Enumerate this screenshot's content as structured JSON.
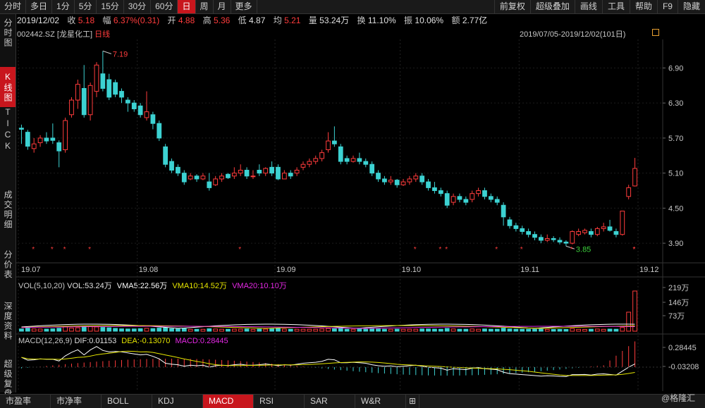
{
  "periods": [
    "分时",
    "多日",
    "1分",
    "5分",
    "15分",
    "30分",
    "60分",
    "日",
    "周",
    "月",
    "更多"
  ],
  "active_period": "日",
  "quote": {
    "date": "2019/12/02",
    "close_label": "收",
    "close": "5.18",
    "change_label": "幅",
    "change": "6.37%(0.31)",
    "open_label": "开",
    "open": "4.88",
    "high_label": "高",
    "high": "5.36",
    "low_label": "低",
    "low": "4.87",
    "avg_label": "均",
    "avg": "5.21",
    "volume_label": "量",
    "volume": "53.24万",
    "turnover_label": "换",
    "turnover": "11.10%",
    "amplitude_label": "振",
    "amplitude": "10.06%",
    "amount_label": "额",
    "amount": "2.77亿"
  },
  "tools": [
    "前复权",
    "超级叠加",
    "画线",
    "工具",
    "帮助",
    "F9",
    "隐藏"
  ],
  "sidebar": [
    "分时图",
    "K线图",
    "TICK",
    "成交明细",
    "分价表",
    "深度资料",
    "超级复盘"
  ],
  "stock": {
    "code": "002442.SZ",
    "name": "[龙星化工]",
    "type": "日线"
  },
  "range": "2019/07/05-2019/12/02(101日)",
  "price_axis": [
    "6.90",
    "6.30",
    "5.70",
    "5.10",
    "4.50",
    "3.90"
  ],
  "date_axis": [
    "19.07",
    "19.08",
    "19.09",
    "19.10",
    "19.11",
    "19.12"
  ],
  "annotations": {
    "high": "7.19",
    "low": "3.85"
  },
  "volume_indicator": {
    "title": "VOL(5,10,20)",
    "vol": "VOL:53.24万",
    "vma5": "VMA5:22.56万",
    "vma10": "VMA10:14.52万",
    "vma20": "VMA20:10.10万",
    "axis": [
      "219万",
      "146万",
      "73万"
    ]
  },
  "macd_indicator": {
    "title": "MACD(12,26,9)",
    "dif": "DIF:0.01153",
    "dea": "DEA:-0.13070",
    "macd": "MACD:0.28445",
    "axis": [
      "0.28445",
      "-0.03208"
    ]
  },
  "bottom_tabs": [
    "市盈率",
    "市净率",
    "BOLL",
    "KDJ",
    "MACD",
    "RSI",
    "SAR",
    "W&R"
  ],
  "active_bottom": "MACD",
  "watermark": "@格隆汇",
  "colors": {
    "up": "#ff3c3c",
    "down": "#3cd2d2",
    "active": "#c8161d",
    "vma5": "#ffffff",
    "vma10": "#e6e600",
    "vma20": "#e628e6"
  },
  "chart_data": {
    "type": "candlestick",
    "ylim": [
      3.6,
      7.4
    ],
    "candles": [
      {
        "o": 5.87,
        "c": 5.85,
        "h": 5.93,
        "l": 5.6
      },
      {
        "o": 5.8,
        "c": 5.56,
        "h": 5.84,
        "l": 5.5
      },
      {
        "o": 5.52,
        "c": 5.6,
        "h": 5.7,
        "l": 5.45
      },
      {
        "o": 5.62,
        "c": 5.7,
        "h": 5.75,
        "l": 5.55
      },
      {
        "o": 5.7,
        "c": 5.65,
        "h": 5.8,
        "l": 5.6
      },
      {
        "o": 5.7,
        "c": 5.66,
        "h": 5.95,
        "l": 5.6
      },
      {
        "o": 5.62,
        "c": 5.48,
        "h": 5.66,
        "l": 5.2
      },
      {
        "o": 5.5,
        "c": 6.0,
        "h": 6.05,
        "l": 5.45
      },
      {
        "o": 6.1,
        "c": 6.35,
        "h": 6.4,
        "l": 6.05
      },
      {
        "o": 6.35,
        "c": 6.62,
        "h": 6.7,
        "l": 6.2
      },
      {
        "o": 6.55,
        "c": 6.1,
        "h": 6.95,
        "l": 6.05
      },
      {
        "o": 6.1,
        "c": 6.6,
        "h": 6.65,
        "l": 6.0
      },
      {
        "o": 6.5,
        "c": 6.95,
        "h": 7.0,
        "l": 6.4
      },
      {
        "o": 6.8,
        "c": 6.55,
        "h": 7.19,
        "l": 6.5
      },
      {
        "o": 6.7,
        "c": 6.4,
        "h": 6.8,
        "l": 6.35
      },
      {
        "o": 6.65,
        "c": 6.45,
        "h": 6.7,
        "l": 6.4
      },
      {
        "o": 6.5,
        "c": 6.4,
        "h": 6.55,
        "l": 6.3
      },
      {
        "o": 6.35,
        "c": 6.3,
        "h": 6.4,
        "l": 6.15
      },
      {
        "o": 6.3,
        "c": 6.2,
        "h": 6.35,
        "l": 6.15
      },
      {
        "o": 6.25,
        "c": 6.1,
        "h": 6.3,
        "l": 6.05
      },
      {
        "o": 6.05,
        "c": 6.15,
        "h": 6.5,
        "l": 6.0
      },
      {
        "o": 6.1,
        "c": 5.95,
        "h": 6.15,
        "l": 5.85
      },
      {
        "o": 5.95,
        "c": 5.7,
        "h": 6.0,
        "l": 5.65
      },
      {
        "o": 5.55,
        "c": 5.25,
        "h": 5.6,
        "l": 5.2
      },
      {
        "o": 5.3,
        "c": 5.15,
        "h": 5.35,
        "l": 5.1
      },
      {
        "o": 5.2,
        "c": 5.1,
        "h": 5.25,
        "l": 5.05
      },
      {
        "o": 5.1,
        "c": 4.95,
        "h": 5.15,
        "l": 4.9
      },
      {
        "o": 5.0,
        "c": 5.05,
        "h": 5.1,
        "l": 4.98
      },
      {
        "o": 5.05,
        "c": 5.0,
        "h": 5.08,
        "l": 4.95
      },
      {
        "o": 5.0,
        "c": 5.05,
        "h": 5.1,
        "l": 4.98
      },
      {
        "o": 4.95,
        "c": 4.85,
        "h": 5.1,
        "l": 4.8
      },
      {
        "o": 4.9,
        "c": 5.0,
        "h": 5.05,
        "l": 4.88
      },
      {
        "o": 5.0,
        "c": 5.05,
        "h": 5.1,
        "l": 4.95
      },
      {
        "o": 5.08,
        "c": 5.02,
        "h": 5.1,
        "l": 5.0
      },
      {
        "o": 5.05,
        "c": 5.1,
        "h": 5.2,
        "l": 5.0
      },
      {
        "o": 5.1,
        "c": 5.15,
        "h": 5.25,
        "l": 5.05
      },
      {
        "o": 5.15,
        "c": 5.05,
        "h": 5.2,
        "l": 5.0
      },
      {
        "o": 5.05,
        "c": 5.05,
        "h": 5.15,
        "l": 5.0
      },
      {
        "o": 5.15,
        "c": 5.1,
        "h": 5.25,
        "l": 5.05
      },
      {
        "o": 5.1,
        "c": 5.18,
        "h": 5.2,
        "l": 5.05
      },
      {
        "o": 5.2,
        "c": 5.1,
        "h": 5.3,
        "l": 5.05
      },
      {
        "o": 5.2,
        "c": 5.0,
        "h": 5.25,
        "l": 4.98
      },
      {
        "o": 5.0,
        "c": 5.1,
        "h": 5.15,
        "l": 5.0
      },
      {
        "o": 5.1,
        "c": 5.05,
        "h": 5.15,
        "l": 5.0
      },
      {
        "o": 5.1,
        "c": 5.15,
        "h": 5.2,
        "l": 5.05
      },
      {
        "o": 5.2,
        "c": 5.25,
        "h": 5.3,
        "l": 5.15
      },
      {
        "o": 5.25,
        "c": 5.3,
        "h": 5.35,
        "l": 5.2
      },
      {
        "o": 5.3,
        "c": 5.35,
        "h": 5.4,
        "l": 5.25
      },
      {
        "o": 5.35,
        "c": 5.45,
        "h": 5.5,
        "l": 5.3
      },
      {
        "o": 5.5,
        "c": 5.65,
        "h": 5.8,
        "l": 5.45
      },
      {
        "o": 5.65,
        "c": 5.6,
        "h": 5.9,
        "l": 5.55
      },
      {
        "o": 5.55,
        "c": 5.3,
        "h": 5.6,
        "l": 5.25
      },
      {
        "o": 5.35,
        "c": 5.3,
        "h": 5.4,
        "l": 5.25
      },
      {
        "o": 5.3,
        "c": 5.35,
        "h": 5.4,
        "l": 5.28
      },
      {
        "o": 5.35,
        "c": 5.3,
        "h": 5.45,
        "l": 5.25
      },
      {
        "o": 5.3,
        "c": 5.25,
        "h": 5.35,
        "l": 5.2
      },
      {
        "o": 5.25,
        "c": 5.1,
        "h": 5.3,
        "l": 5.05
      },
      {
        "o": 5.1,
        "c": 5.0,
        "h": 5.15,
        "l": 4.95
      },
      {
        "o": 5.0,
        "c": 4.95,
        "h": 5.05,
        "l": 4.9
      },
      {
        "o": 4.95,
        "c": 4.98,
        "h": 5.05,
        "l": 4.9
      },
      {
        "o": 4.98,
        "c": 4.9,
        "h": 5.0,
        "l": 4.85
      },
      {
        "o": 4.9,
        "c": 4.95,
        "h": 5.0,
        "l": 4.88
      },
      {
        "o": 4.95,
        "c": 5.0,
        "h": 5.05,
        "l": 4.9
      },
      {
        "o": 5.0,
        "c": 5.05,
        "h": 5.1,
        "l": 4.95
      },
      {
        "o": 5.05,
        "c": 4.95,
        "h": 5.1,
        "l": 4.9
      },
      {
        "o": 4.95,
        "c": 4.85,
        "h": 5.0,
        "l": 4.8
      },
      {
        "o": 4.85,
        "c": 4.8,
        "h": 4.95,
        "l": 4.75
      },
      {
        "o": 4.8,
        "c": 4.75,
        "h": 4.85,
        "l": 4.7
      },
      {
        "o": 4.75,
        "c": 4.55,
        "h": 4.8,
        "l": 4.5
      },
      {
        "o": 4.6,
        "c": 4.7,
        "h": 4.75,
        "l": 4.55
      },
      {
        "o": 4.7,
        "c": 4.65,
        "h": 4.75,
        "l": 4.6
      },
      {
        "o": 4.65,
        "c": 4.6,
        "h": 4.7,
        "l": 4.55
      },
      {
        "o": 4.65,
        "c": 4.75,
        "h": 4.8,
        "l": 4.6
      },
      {
        "o": 4.75,
        "c": 4.8,
        "h": 4.85,
        "l": 4.7
      },
      {
        "o": 4.8,
        "c": 4.7,
        "h": 4.85,
        "l": 4.65
      },
      {
        "o": 4.7,
        "c": 4.65,
        "h": 4.75,
        "l": 4.6
      },
      {
        "o": 4.65,
        "c": 4.6,
        "h": 4.7,
        "l": 4.55
      },
      {
        "o": 4.55,
        "c": 4.35,
        "h": 4.6,
        "l": 4.2
      },
      {
        "o": 4.3,
        "c": 4.2,
        "h": 4.35,
        "l": 4.15
      },
      {
        "o": 4.2,
        "c": 4.15,
        "h": 4.25,
        "l": 4.1
      },
      {
        "o": 4.15,
        "c": 4.1,
        "h": 4.2,
        "l": 4.05
      },
      {
        "o": 4.1,
        "c": 4.05,
        "h": 4.15,
        "l": 4.0
      },
      {
        "o": 4.05,
        "c": 4.0,
        "h": 4.1,
        "l": 3.95
      },
      {
        "o": 4.0,
        "c": 3.95,
        "h": 4.05,
        "l": 3.9
      },
      {
        "o": 3.95,
        "c": 3.98,
        "h": 4.05,
        "l": 3.92
      },
      {
        "o": 3.98,
        "c": 3.96,
        "h": 4.02,
        "l": 3.92
      },
      {
        "o": 3.95,
        "c": 3.92,
        "h": 4.0,
        "l": 3.88
      },
      {
        "o": 3.92,
        "c": 3.9,
        "h": 3.95,
        "l": 3.85
      },
      {
        "o": 3.9,
        "c": 4.1,
        "h": 4.12,
        "l": 3.88
      },
      {
        "o": 4.05,
        "c": 4.1,
        "h": 4.15,
        "l": 4.02
      },
      {
        "o": 4.08,
        "c": 4.12,
        "h": 4.15,
        "l": 4.05
      },
      {
        "o": 4.1,
        "c": 4.05,
        "h": 4.15,
        "l": 4.0
      },
      {
        "o": 4.05,
        "c": 4.15,
        "h": 4.18,
        "l": 4.02
      },
      {
        "o": 4.15,
        "c": 4.18,
        "h": 4.25,
        "l": 4.1
      },
      {
        "o": 4.18,
        "c": 4.12,
        "h": 4.3,
        "l": 4.1
      },
      {
        "o": 4.1,
        "c": 4.05,
        "h": 4.15,
        "l": 4.0
      },
      {
        "o": 4.05,
        "c": 4.45,
        "h": 4.45,
        "l": 4.03
      },
      {
        "o": 4.7,
        "c": 4.85,
        "h": 4.9,
        "l": 4.65
      },
      {
        "o": 4.88,
        "c": 5.18,
        "h": 5.36,
        "l": 4.87
      }
    ]
  }
}
